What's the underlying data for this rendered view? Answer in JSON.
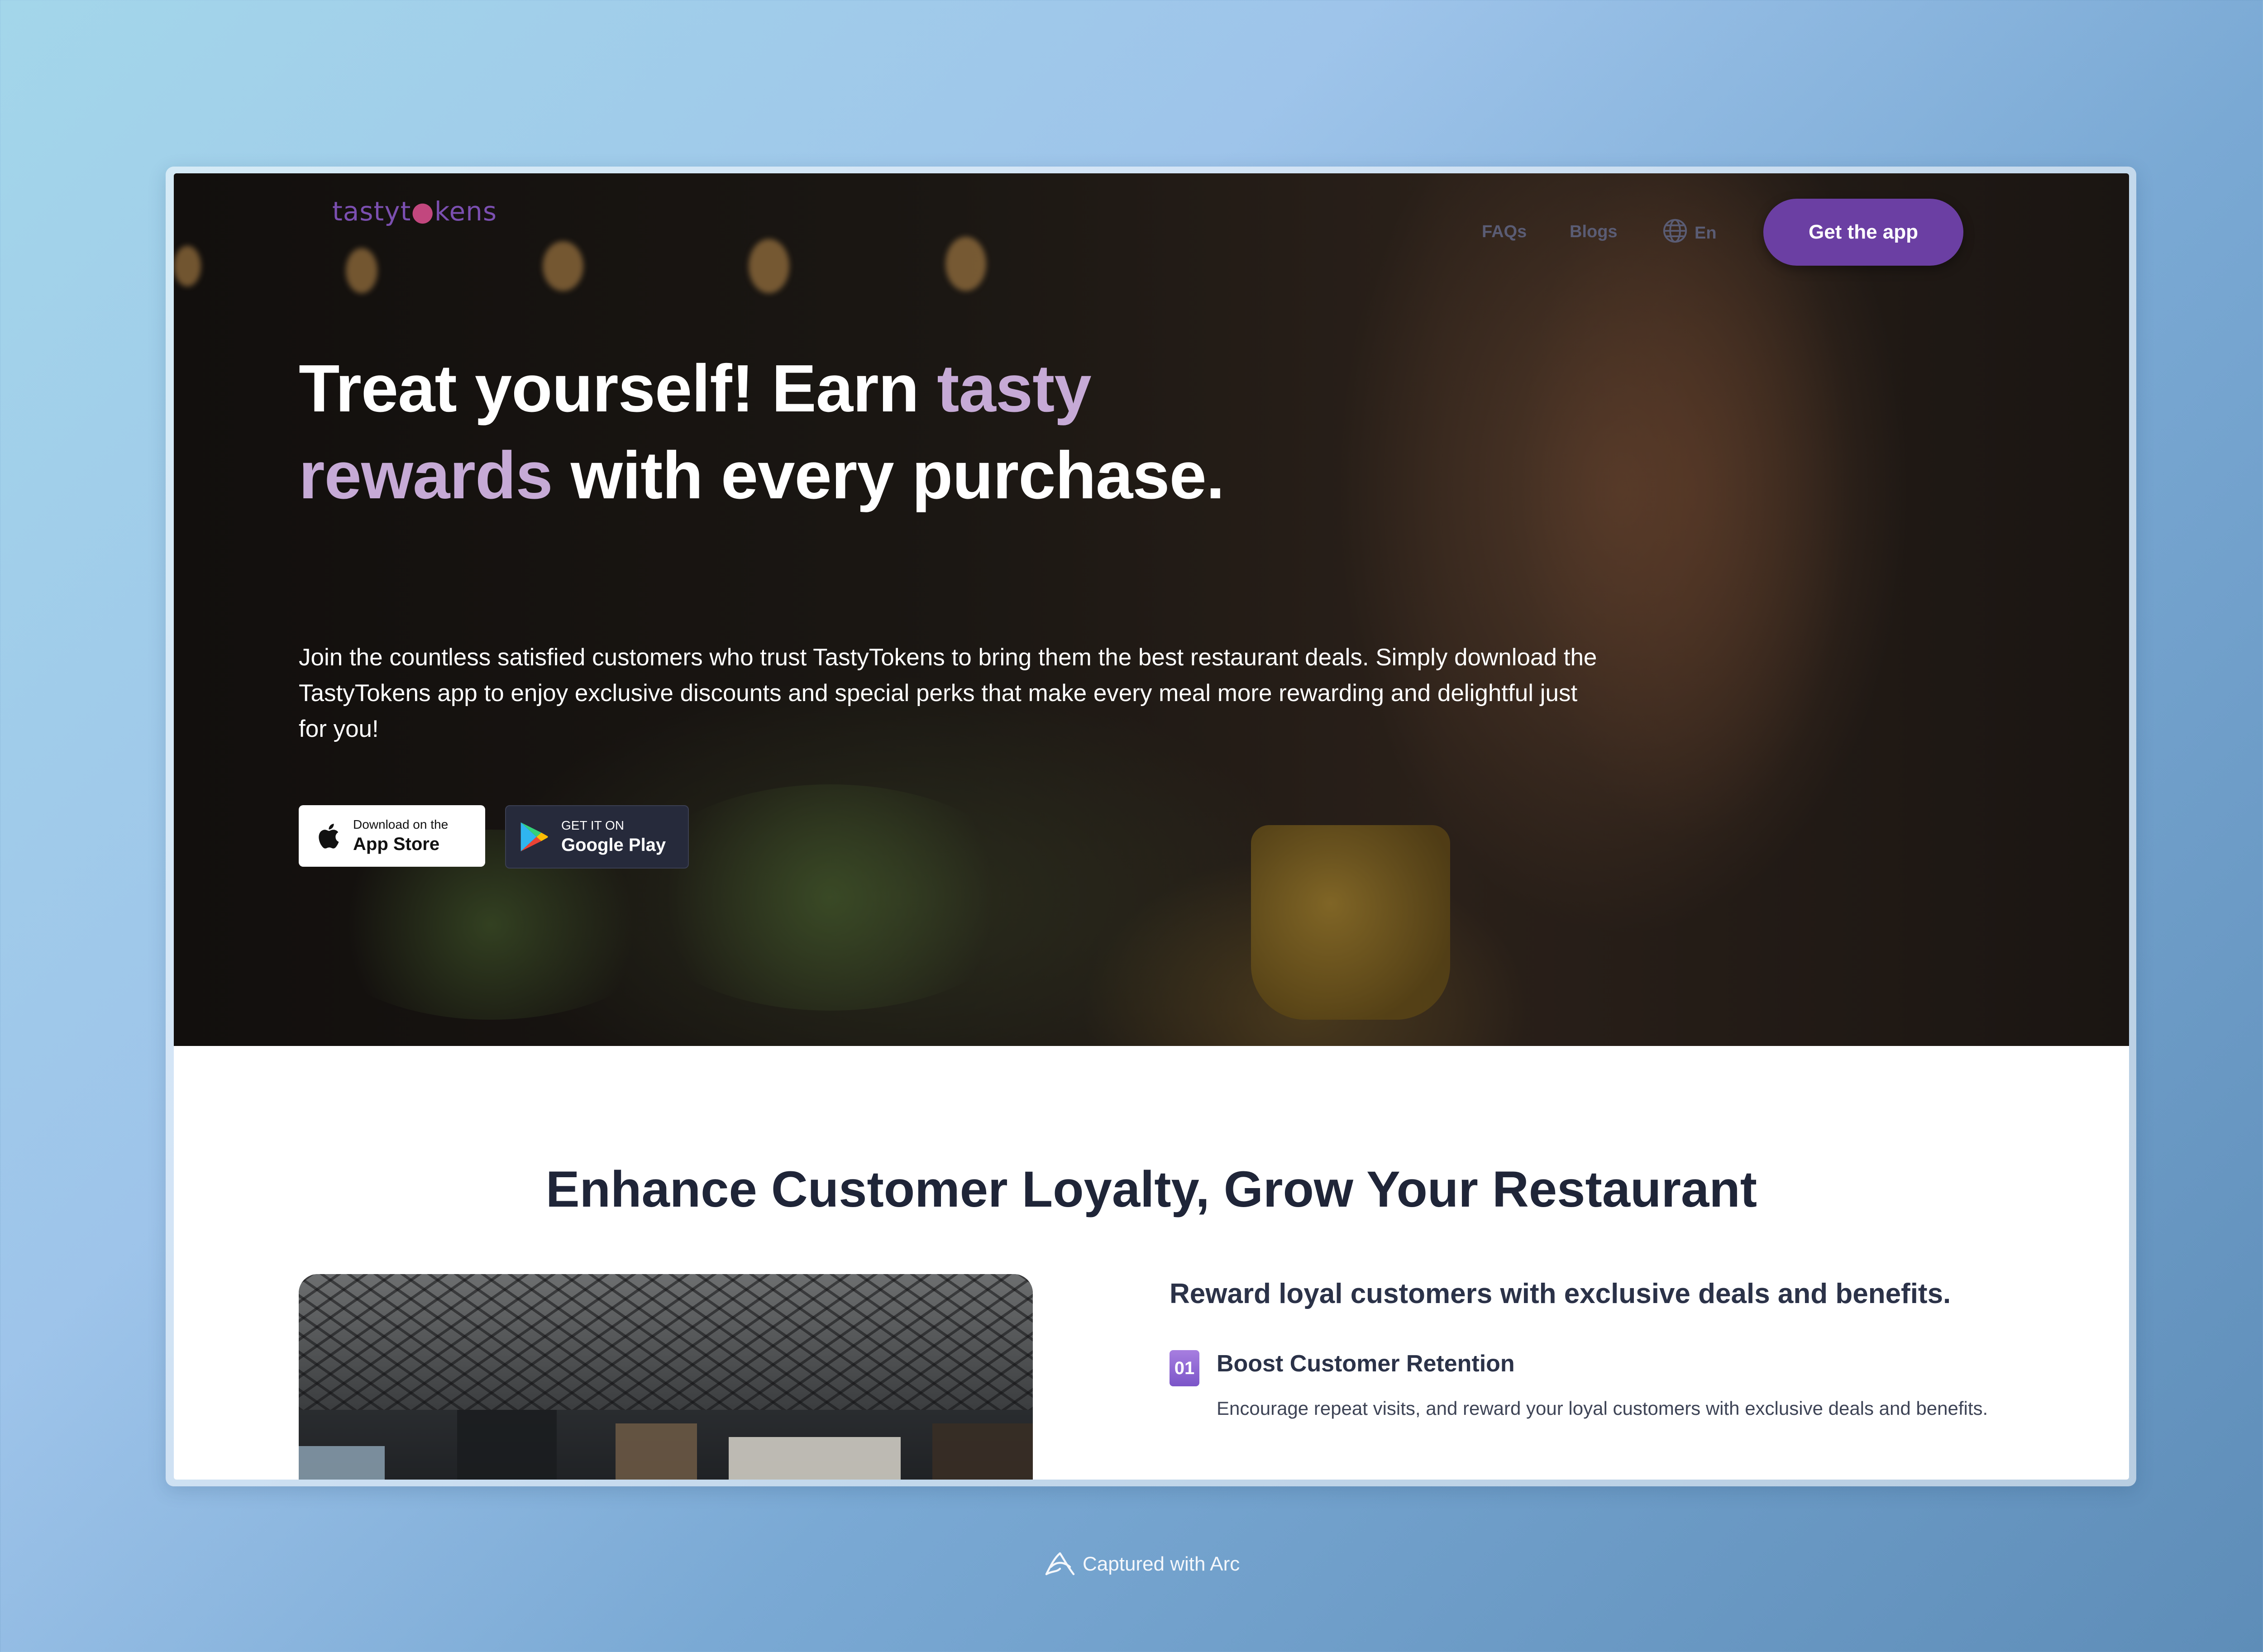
{
  "nav": {
    "logo_text_a": "tastyt",
    "logo_text_b": "kens",
    "faqs": "FAQs",
    "blogs": "Blogs",
    "language": "En",
    "cta": "Get the app"
  },
  "hero": {
    "headline_part1": "Treat yourself! Earn ",
    "headline_accent": "tasty rewards",
    "headline_part2": " with every purchase.",
    "subtext": "Join the countless satisfied customers who trust TastyTokens to bring them the best restaurant deals. Simply download the TastyTokens app to enjoy exclusive discounts and special perks that make every meal more rewarding and delightful just for you!",
    "appstore_small": "Download on the",
    "appstore_big": "App Store",
    "googleplay_small": "GET IT ON",
    "googleplay_big": "Google Play"
  },
  "section": {
    "title": "Enhance Customer Loyalty, Grow Your Restaurant",
    "subheading": "Reward loyal customers with exclusive deals and benefits.",
    "steps": [
      {
        "num": "01",
        "title": "Boost Customer Retention",
        "desc": "Encourage repeat visits, and reward your loyal customers with exclusive deals and benefits."
      }
    ]
  },
  "footer": {
    "credit": "Captured with Arc"
  },
  "colors": {
    "accent": "#6b3fa3",
    "headline_accent": "#c6aad6",
    "logo": "#7b4fb0"
  }
}
